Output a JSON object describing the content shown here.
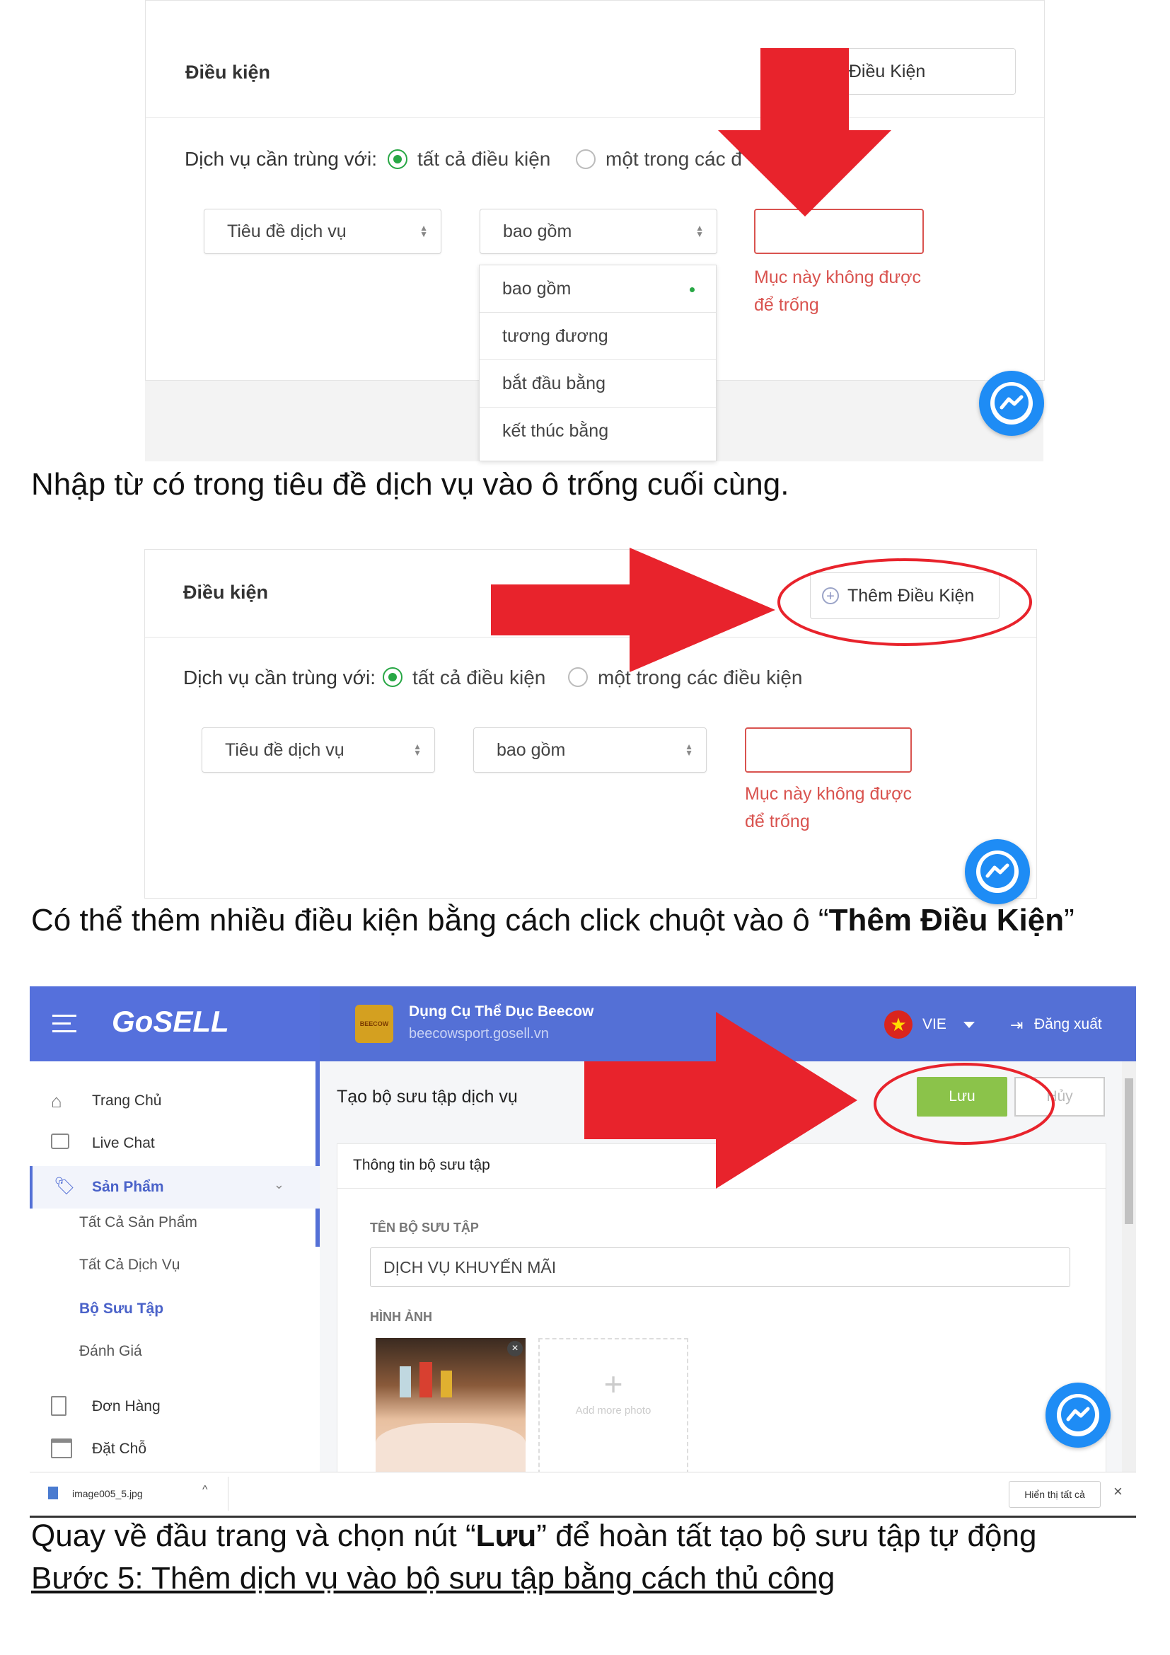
{
  "panel1": {
    "title": "Điều kiện",
    "add_condition": "Thêm Điều Kiện",
    "match_label": "Dịch vụ cần trùng với:",
    "option_all": "tất cả điều kiện",
    "option_any": "một trong các đ",
    "field_select": "Tiêu đề dịch vụ",
    "operator_select": "bao gồm",
    "error_line1": "Mục này không được",
    "error_line2": "để trống",
    "dropdown_options": [
      "bao gồm",
      "tương đương",
      "bắt đầu bằng",
      "kết thúc bằng"
    ]
  },
  "caption1": "Nhập từ có trong tiêu đề dịch vụ vào ô trống cuối cùng.",
  "panel2": {
    "title": "Điều kiện",
    "add_condition": "Thêm Điều Kiện",
    "match_label": "Dịch vụ cần trùng với:",
    "option_all": "tất cả điều kiện",
    "option_any": "một trong các điều kiện",
    "field_select": "Tiêu đề dịch vụ",
    "operator_select": "bao gồm",
    "error_line1": "Mục này không được",
    "error_line2": "để trống"
  },
  "caption2": {
    "before": "Có thể thêm nhiều điều kiện bằng cách click chuột vào ô “",
    "bold": "Thêm Điều Kiện",
    "after": "”"
  },
  "admin": {
    "brand": "GoSELL",
    "store_name": "Dụng Cụ Thể Dục Beecow",
    "store_url": "beecowsport.gosell.vn",
    "store_logo_text": "BEECOW",
    "language": "VIE",
    "logout": "Đăng xuất",
    "sidebar": {
      "home": "Trang Chủ",
      "live_chat": "Live Chat",
      "products": "Sản Phẩm",
      "all_products": "Tất Cả Sản Phẩm",
      "all_services": "Tất Cả Dịch Vụ",
      "collections": "Bộ Sưu Tập",
      "reviews": "Đánh Giá",
      "orders": "Đơn Hàng",
      "booking": "Đặt Chỗ"
    },
    "page_title": "Tạo bộ sưu tập dịch vụ",
    "save": "Lưu",
    "cancel": "Hủy",
    "section_title": "Thông tin bộ sưu tập",
    "name_label": "TÊN BỘ SƯU TẬP",
    "name_value": "DỊCH VỤ KHUYẾN MÃI",
    "image_label": "HÌNH ẢNH",
    "add_photo": "Add more photo",
    "download_file": "image005_5.jpg",
    "show_all": "Hiển thị tất cả"
  },
  "caption3": {
    "before": "Quay về đầu trang và chọn nút “",
    "bold": "Lưu",
    "after": "” để hoàn tất tạo bộ sưu tập tự động"
  },
  "step5": "Bước 5: Thêm dịch vụ vào bộ sưu tập bằng cách thủ công",
  "colors": {
    "arrow_red": "#e8232c",
    "brand_blue": "#5470d6",
    "error_red": "#d9534f",
    "success_green": "#28a745",
    "save_green": "#8bc34a"
  }
}
